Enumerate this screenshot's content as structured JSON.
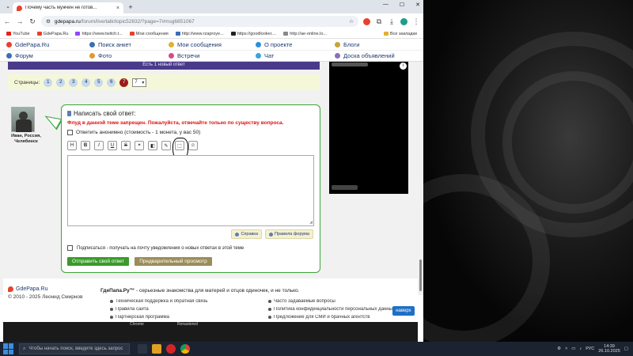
{
  "browser": {
    "tab_title": "Почему часть мужчин не готов...",
    "url_domain": "gdepapa.ru",
    "url_path": "/forum/live/talk/topic52832/?page=7#msg6851067",
    "bookmarks": [
      "YouTube",
      "GdePapa.Ru",
      "https://www.twitch.t...",
      "Мои сообщения",
      "http://www.rzaproye...",
      "https://goodlooker....",
      "http://ae-online.lo..."
    ],
    "bookmarks_folder": "Все закладки"
  },
  "sitenav": {
    "row1": [
      "GdePapa.Ru",
      "Поиск анкет",
      "Мои сообщения",
      "О проекте",
      "Блоги"
    ],
    "row2": [
      "Форум",
      "Фото",
      "Встречи",
      "Чат",
      "Доска объявлений"
    ]
  },
  "banner": {
    "text": "Есть 1 новый ответ"
  },
  "pager": {
    "label": "Страницы:",
    "pages": [
      "1",
      "2",
      "3",
      "4",
      "5",
      "6"
    ],
    "current": "7",
    "select_value": "7"
  },
  "user": {
    "name": "Иван, Россия, Челябинск"
  },
  "reply": {
    "title": "Написать свой ответ:",
    "warning": "Флуд в данной теме запрещен. Пожалуйста, отвечайте только по существу вопроса.",
    "anon_label": "Ответить анонимно (стоимость - 1 монета, у вас 50)",
    "format_buttons": [
      "H",
      "B",
      "I",
      "U",
      "S",
      "❝",
      "◧",
      "✎",
      "⬚",
      "☺"
    ],
    "help_label": "Справка",
    "rules_label": "Правила форума",
    "subscribe_label": "Подписаться - получать на почту уведомления о новых ответах в этой теме",
    "send_label": "Отправить свой ответ",
    "preview_label": "Предварительный просмотр"
  },
  "footer": {
    "logo": "GdePapa.Ru",
    "copyright": "© 2010 - 2025 Леонид Смирнов",
    "slogan_brand": "ГдеПапа.Ру™",
    "slogan_rest": " - серьезные знакомства для матерей и отцов одиночек, и не только.",
    "links": [
      "Техническая поддержка и обратная связь",
      "Часто задаваемые вопросы",
      "Правила сайта",
      "Политика конфиденциальности персональных данных",
      "Партнерская программа",
      "Предложение для СМИ и брачных агентств"
    ],
    "top_button": "наверх"
  },
  "bottom_strip": {
    "left": "Chrome",
    "right": "Renastered"
  },
  "taskbar": {
    "search_placeholder": "Чтобы начать поиск, введите здесь запрос",
    "lang": "РУС",
    "time": "14:39",
    "date": "26.10.2025"
  }
}
